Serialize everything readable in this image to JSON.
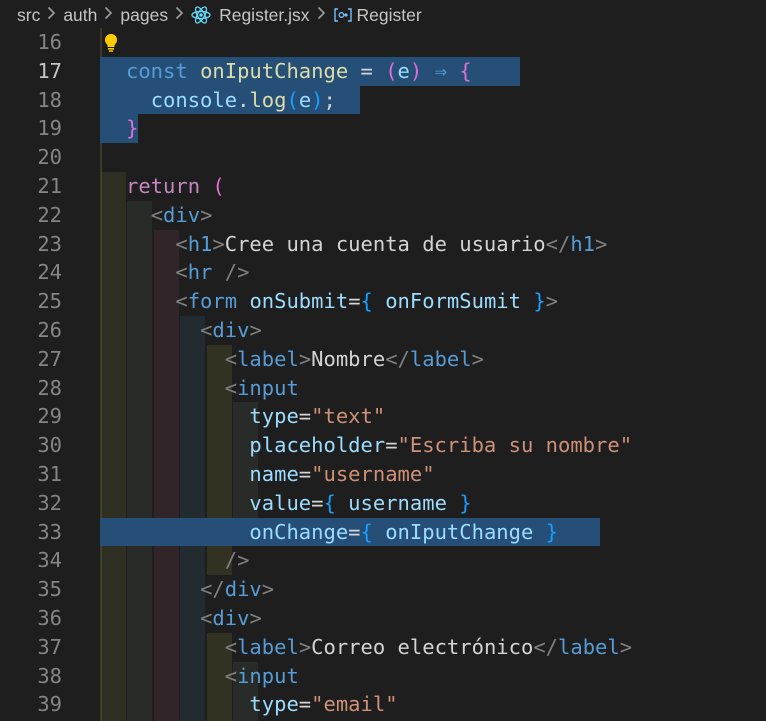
{
  "breadcrumb": {
    "items": [
      "src",
      "auth",
      "pages",
      "Register.jsx",
      "Register"
    ],
    "file_icon": "react-icon",
    "symbol_icon": "symbol-class-icon"
  },
  "editor": {
    "active_line": 17,
    "lines": [
      {
        "n": "16",
        "tokens": []
      },
      {
        "n": "17",
        "tokens": [
          [
            "kb",
            "const"
          ],
          [
            "t",
            " "
          ],
          [
            "f",
            "onIputChange"
          ],
          [
            "t",
            " "
          ],
          [
            "op",
            "="
          ],
          [
            "t",
            " "
          ],
          [
            "b2",
            "("
          ],
          [
            "v",
            "e"
          ],
          [
            "b2",
            ")"
          ],
          [
            "t",
            " "
          ],
          [
            "kb",
            "⇒"
          ],
          [
            "t",
            " "
          ],
          [
            "b2",
            "{"
          ]
        ]
      },
      {
        "n": "18",
        "tokens": [
          [
            "t",
            "  "
          ],
          [
            "v",
            "console"
          ],
          [
            "t",
            "."
          ],
          [
            "f",
            "log"
          ],
          [
            "b3",
            "("
          ],
          [
            "v",
            "e"
          ],
          [
            "b3",
            ")"
          ],
          [
            "t",
            ";"
          ]
        ]
      },
      {
        "n": "19",
        "tokens": [
          [
            "b2",
            "}"
          ]
        ]
      },
      {
        "n": "20",
        "tokens": []
      },
      {
        "n": "21",
        "tokens": [
          [
            "k",
            "return"
          ],
          [
            "t",
            " "
          ],
          [
            "b2",
            "("
          ]
        ]
      },
      {
        "n": "22",
        "tokens": [
          [
            "t",
            "  "
          ],
          [
            "br",
            "<"
          ],
          [
            "tag",
            "div"
          ],
          [
            "br",
            ">"
          ]
        ]
      },
      {
        "n": "23",
        "tokens": [
          [
            "t",
            "    "
          ],
          [
            "br",
            "<"
          ],
          [
            "tag",
            "h1"
          ],
          [
            "br",
            ">"
          ],
          [
            "t",
            "Cree una cuenta de usuario"
          ],
          [
            "br",
            "</"
          ],
          [
            "tag",
            "h1"
          ],
          [
            "br",
            ">"
          ]
        ]
      },
      {
        "n": "24",
        "tokens": [
          [
            "t",
            "    "
          ],
          [
            "br",
            "<"
          ],
          [
            "tag",
            "hr"
          ],
          [
            "t",
            " "
          ],
          [
            "br",
            "/>"
          ]
        ]
      },
      {
        "n": "25",
        "tokens": [
          [
            "t",
            "    "
          ],
          [
            "br",
            "<"
          ],
          [
            "tag",
            "form"
          ],
          [
            "t",
            " "
          ],
          [
            "attr",
            "onSubmit"
          ],
          [
            "t",
            "="
          ],
          [
            "b3",
            "{"
          ],
          [
            "t",
            " "
          ],
          [
            "v",
            "onFormSumit"
          ],
          [
            "t",
            " "
          ],
          [
            "b3",
            "}"
          ],
          [
            "br",
            ">"
          ]
        ]
      },
      {
        "n": "26",
        "tokens": [
          [
            "t",
            "      "
          ],
          [
            "br",
            "<"
          ],
          [
            "tag",
            "div"
          ],
          [
            "br",
            ">"
          ]
        ]
      },
      {
        "n": "27",
        "tokens": [
          [
            "t",
            "        "
          ],
          [
            "br",
            "<"
          ],
          [
            "tag",
            "label"
          ],
          [
            "br",
            ">"
          ],
          [
            "t",
            "Nombre"
          ],
          [
            "br",
            "</"
          ],
          [
            "tag",
            "label"
          ],
          [
            "br",
            ">"
          ]
        ]
      },
      {
        "n": "28",
        "tokens": [
          [
            "t",
            "        "
          ],
          [
            "br",
            "<"
          ],
          [
            "tag",
            "input"
          ]
        ]
      },
      {
        "n": "29",
        "tokens": [
          [
            "t",
            "          "
          ],
          [
            "attr",
            "type"
          ],
          [
            "t",
            "="
          ],
          [
            "str",
            "\"text\""
          ]
        ]
      },
      {
        "n": "30",
        "tokens": [
          [
            "t",
            "          "
          ],
          [
            "attr",
            "placeholder"
          ],
          [
            "t",
            "="
          ],
          [
            "str",
            "\"Escriba su nombre\""
          ]
        ]
      },
      {
        "n": "31",
        "tokens": [
          [
            "t",
            "          "
          ],
          [
            "attr",
            "name"
          ],
          [
            "t",
            "="
          ],
          [
            "str",
            "\"username\""
          ]
        ]
      },
      {
        "n": "32",
        "tokens": [
          [
            "t",
            "          "
          ],
          [
            "attr",
            "value"
          ],
          [
            "t",
            "="
          ],
          [
            "b3",
            "{"
          ],
          [
            "t",
            " "
          ],
          [
            "v",
            "username"
          ],
          [
            "t",
            " "
          ],
          [
            "b3",
            "}"
          ]
        ]
      },
      {
        "n": "33",
        "tokens": [
          [
            "t",
            "          "
          ],
          [
            "attr",
            "onChange"
          ],
          [
            "t",
            "="
          ],
          [
            "b3",
            "{"
          ],
          [
            "t",
            " "
          ],
          [
            "v",
            "onIputChange"
          ],
          [
            "t",
            " "
          ],
          [
            "b3",
            "}"
          ]
        ]
      },
      {
        "n": "34",
        "tokens": [
          [
            "t",
            "        "
          ],
          [
            "br",
            "/>"
          ]
        ]
      },
      {
        "n": "35",
        "tokens": [
          [
            "t",
            "      "
          ],
          [
            "br",
            "</"
          ],
          [
            "tag",
            "div"
          ],
          [
            "br",
            ">"
          ]
        ]
      },
      {
        "n": "36",
        "tokens": [
          [
            "t",
            "      "
          ],
          [
            "br",
            "<"
          ],
          [
            "tag",
            "div"
          ],
          [
            "br",
            ">"
          ]
        ]
      },
      {
        "n": "37",
        "tokens": [
          [
            "t",
            "        "
          ],
          [
            "br",
            "<"
          ],
          [
            "tag",
            "label"
          ],
          [
            "br",
            ">"
          ],
          [
            "t",
            "Correo electrónico"
          ],
          [
            "br",
            "</"
          ],
          [
            "tag",
            "label"
          ],
          [
            "br",
            ">"
          ]
        ]
      },
      {
        "n": "38",
        "tokens": [
          [
            "t",
            "        "
          ],
          [
            "br",
            "<"
          ],
          [
            "tag",
            "input"
          ]
        ]
      },
      {
        "n": "39",
        "tokens": [
          [
            "t",
            "          "
          ],
          [
            "attr",
            "type"
          ],
          [
            "t",
            "="
          ],
          [
            "str",
            "\"email\""
          ]
        ]
      }
    ]
  }
}
